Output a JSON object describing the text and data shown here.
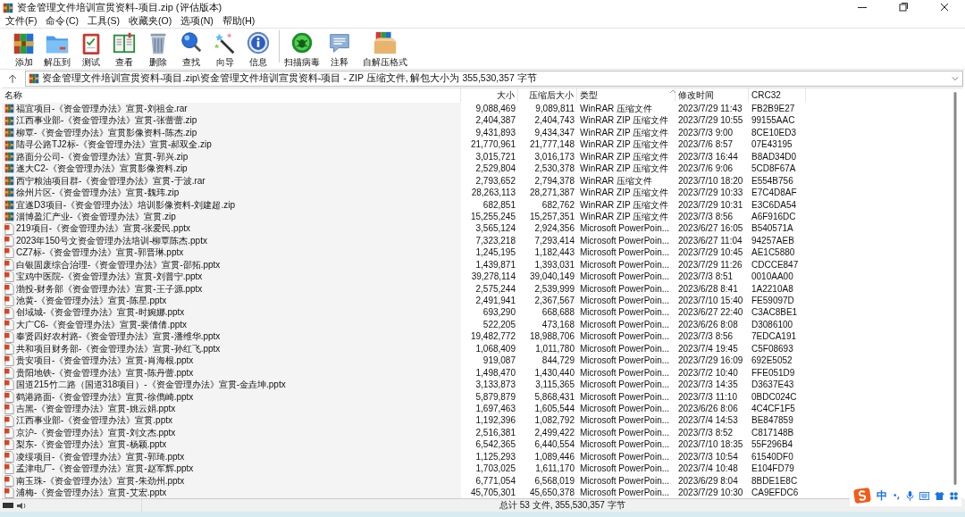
{
  "window": {
    "title": "资金管理文件培训宣贯资料-项目.zip (评估版本)"
  },
  "menu": [
    "文件(F)",
    "命令(C)",
    "工具(S)",
    "收藏夹(O)",
    "选项(N)",
    "帮助(H)"
  ],
  "toolbar": {
    "groups": [
      [
        "添加",
        "解压到",
        "测试",
        "查看",
        "删除",
        "查找",
        "向导",
        "信息"
      ],
      [
        "扫描病毒",
        "注释",
        "自解压格式"
      ]
    ]
  },
  "address": {
    "path": "资金管理文件培训宣贯资料-项目.zip\\资金管理文件培训宣贯资料-项目 - ZIP 压缩文件, 解包大小为 355,530,357 字节"
  },
  "table": {
    "columns": [
      "名称",
      "大小",
      "压缩后大小",
      "类型",
      "修改时间",
      "CRC32"
    ],
    "rows": [
      {
        "kind": "archive",
        "name": "福宜项目-《资金管理办法》宣贯-刘祖金.rar",
        "size": "9,088,469",
        "packed": "9,089,811",
        "type": "WinRAR 压缩文件",
        "modified": "2023/7/29 11:43",
        "crc": "FB2B9E27"
      },
      {
        "kind": "archive",
        "name": "江西事业部-《资金管理办法》宣贯-张蕾蕾.zip",
        "size": "2,404,387",
        "packed": "2,404,743",
        "type": "WinRAR ZIP 压缩文件",
        "modified": "2023/7/29 10:55",
        "crc": "99155AAC"
      },
      {
        "kind": "archive",
        "name": "柳覃-《资金管理办法》宣贯影像资料-陈杰.zip",
        "size": "9,431,893",
        "packed": "9,434,347",
        "type": "WinRAR ZIP 压缩文件",
        "modified": "2023/7/3 9:00",
        "crc": "8CE10ED3"
      },
      {
        "kind": "archive",
        "name": "陆寻公路TJ2标-《资金管理办法》宣贯-郝双全.zip",
        "size": "21,770,961",
        "packed": "21,777,148",
        "type": "WinRAR ZIP 压缩文件",
        "modified": "2023/7/6 8:57",
        "crc": "07E43195"
      },
      {
        "kind": "archive",
        "name": "路面分公司-《资金管理办法》宣贯-郭兴.zip",
        "size": "3,015,721",
        "packed": "3,016,173",
        "type": "WinRAR ZIP 压缩文件",
        "modified": "2023/7/3 16:44",
        "crc": "B8AD34D0"
      },
      {
        "kind": "archive",
        "name": "遂大C2-《资金管理办法》宣贯影像资料.zip",
        "size": "2,529,804",
        "packed": "2,530,378",
        "type": "WinRAR ZIP 压缩文件",
        "modified": "2023/7/6 9:06",
        "crc": "5CD8F67A"
      },
      {
        "kind": "archive",
        "name": "西宁粮油项目群-《资金管理办法》宣贯-于波.rar",
        "size": "2,793,652",
        "packed": "2,794,378",
        "type": "WinRAR 压缩文件",
        "modified": "2023/7/10 18:20",
        "crc": "E554B756"
      },
      {
        "kind": "archive",
        "name": "徐州片区-《资金管理办法》宣贯-魏玮.zip",
        "size": "28,263,113",
        "packed": "28,271,387",
        "type": "WinRAR ZIP 压缩文件",
        "modified": "2023/7/29 10:33",
        "crc": "E7C4D8AF"
      },
      {
        "kind": "archive",
        "name": "宜遂D3项目-《资金管理办法》培训影像资料-刘建超.zip",
        "size": "682,851",
        "packed": "682,762",
        "type": "WinRAR ZIP 压缩文件",
        "modified": "2023/7/29 10:31",
        "crc": "E3C6DA54"
      },
      {
        "kind": "archive",
        "name": "淄博盈汇产业-《资金管理办法》宣贯.zip",
        "size": "15,255,245",
        "packed": "15,257,351",
        "type": "WinRAR ZIP 压缩文件",
        "modified": "2023/7/3 8:56",
        "crc": "A6F916DC"
      },
      {
        "kind": "pptx",
        "name": "219项目-《资金管理办法》宣贯-张爱民.pptx",
        "size": "3,565,124",
        "packed": "2,924,356",
        "type": "Microsoft PowerPoin...",
        "modified": "2023/6/27 16:05",
        "crc": "B540571A"
      },
      {
        "kind": "pptx",
        "name": "2023年150号文资金管理办法培训-柳覃陈杰.pptx",
        "size": "7,323,218",
        "packed": "7,293,414",
        "type": "Microsoft PowerPoin...",
        "modified": "2023/6/27 11:04",
        "crc": "94257AEB"
      },
      {
        "kind": "pptx",
        "name": "CZ7标-《资金管理办法》宣贯-郭晋琳.pptx",
        "size": "1,245,195",
        "packed": "1,182,443",
        "type": "Microsoft PowerPoin...",
        "modified": "2023/7/29 10:45",
        "crc": "AE1C5880"
      },
      {
        "kind": "pptx",
        "name": "白银固废综合治理-《资金管理办法》宣贯-邵拓.pptx",
        "size": "1,439,871",
        "packed": "1,393,031",
        "type": "Microsoft PowerPoin...",
        "modified": "2023/7/29 11:26",
        "crc": "CDCCE847"
      },
      {
        "kind": "pptx",
        "name": "宝鸡中医院-《资金管理办法》宣贯-刘普宁.pptx",
        "size": "39,278,114",
        "packed": "39,040,149",
        "type": "Microsoft PowerPoin...",
        "modified": "2023/7/3 8:51",
        "crc": "0010AA00"
      },
      {
        "kind": "pptx",
        "name": "渤投-财务部《资金管理办法》宣贯-王子源.pptx",
        "size": "2,575,244",
        "packed": "2,539,999",
        "type": "Microsoft PowerPoin...",
        "modified": "2023/6/28 8:41",
        "crc": "1A2210A8"
      },
      {
        "kind": "pptx",
        "name": "池黄-《资金管理办法》宣贯-陈星.pptx",
        "size": "2,491,941",
        "packed": "2,367,567",
        "type": "Microsoft PowerPoin...",
        "modified": "2023/7/10 15:40",
        "crc": "FE59097D"
      },
      {
        "kind": "pptx",
        "name": "创域城-《资金管理办法》宣贯-时婉娜.pptx",
        "size": "693,290",
        "packed": "668,688",
        "type": "Microsoft PowerPoin...",
        "modified": "2023/6/27 22:40",
        "crc": "C3AC8BE1"
      },
      {
        "kind": "pptx",
        "name": "大广C6-《资金管理办法》宣贯-裴倩倩.pptx",
        "size": "522,205",
        "packed": "473,168",
        "type": "Microsoft PowerPoin...",
        "modified": "2023/6/26 8:08",
        "crc": "D3086100"
      },
      {
        "kind": "pptx",
        "name": "奉贤四好农村路-《资金管理办法》宣贯-潘维华.pptx",
        "size": "19,482,772",
        "packed": "18,988,706",
        "type": "Microsoft PowerPoin...",
        "modified": "2023/7/3 8:56",
        "crc": "7EDCA191"
      },
      {
        "kind": "pptx",
        "name": "共和项目财务部-《资金管理办法》宣贯-孙红飞.pptx",
        "size": "1,068,409",
        "packed": "1,011,780",
        "type": "Microsoft PowerPoin...",
        "modified": "2023/7/4 19:45",
        "crc": "C5F08693"
      },
      {
        "kind": "pptx",
        "name": "贵安项目-《资金管理办法》宣贯-肖海根.pptx",
        "size": "919,087",
        "packed": "844,729",
        "type": "Microsoft PowerPoin...",
        "modified": "2023/7/29 16:09",
        "crc": "692E5052"
      },
      {
        "kind": "pptx",
        "name": "贵阳地铁-《资金管理办法》宣贯-陈丹蕾.pptx",
        "size": "1,498,470",
        "packed": "1,430,440",
        "type": "Microsoft PowerPoin...",
        "modified": "2023/7/2 10:40",
        "crc": "FFE051D9"
      },
      {
        "kind": "pptx",
        "name": "国道215竹二路（国道318项目）-《资金管理办法》宣贯-金垚坤.pptx",
        "size": "3,133,873",
        "packed": "3,115,365",
        "type": "Microsoft PowerPoin...",
        "modified": "2023/7/3 14:35",
        "crc": "D3637E43"
      },
      {
        "kind": "pptx",
        "name": "鹤港路面-《资金管理办法》宣贯-徐儁崎.pptx",
        "size": "5,879,879",
        "packed": "5,868,431",
        "type": "Microsoft PowerPoin...",
        "modified": "2023/7/3 11:10",
        "crc": "0BDC024C"
      },
      {
        "kind": "pptx",
        "name": "吉黑-《资金管理办法》宣贯-姚云娟.pptx",
        "size": "1,697,463",
        "packed": "1,605,544",
        "type": "Microsoft PowerPoin...",
        "modified": "2023/6/26 8:06",
        "crc": "4C4CF1F5"
      },
      {
        "kind": "pptx",
        "name": "江西事业部-《资金管理办法》宣贯.pptx",
        "size": "1,192,396",
        "packed": "1,082,792",
        "type": "Microsoft PowerPoin...",
        "modified": "2023/7/4 14:53",
        "crc": "BE847859"
      },
      {
        "kind": "pptx",
        "name": "京沪-《资金管理办法》宣贯-刘文杰.pptx",
        "size": "2,516,381",
        "packed": "2,499,422",
        "type": "Microsoft PowerPoin...",
        "modified": "2023/7/3 8:52",
        "crc": "C817148B"
      },
      {
        "kind": "pptx",
        "name": "梨东-《资金管理办法》宣贯-杨颖.pptx",
        "size": "6,542,365",
        "packed": "6,440,554",
        "type": "Microsoft PowerPoin...",
        "modified": "2023/7/10 18:35",
        "crc": "55F296B4"
      },
      {
        "kind": "pptx",
        "name": "凌绥项目-《资金管理办法》宣贯-郭琦.pptx",
        "size": "1,125,293",
        "packed": "1,089,446",
        "type": "Microsoft PowerPoin...",
        "modified": "2023/7/3 10:54",
        "crc": "61540DF0"
      },
      {
        "kind": "pptx",
        "name": "孟津电厂-《资金管理办法》宣贯-赵军辉.pptx",
        "size": "1,703,025",
        "packed": "1,611,170",
        "type": "Microsoft PowerPoin...",
        "modified": "2023/7/4 10:48",
        "crc": "E104FD79"
      },
      {
        "kind": "pptx",
        "name": "南玉珠-《资金管理办法》宣贯-朱劲州.pptx",
        "size": "6,771,054",
        "packed": "6,568,019",
        "type": "Microsoft PowerPoin...",
        "modified": "2023/6/29 8:04",
        "crc": "8BDE1E8C"
      },
      {
        "kind": "pptx",
        "name": "浦梅-《资金管理办法》宣贯-艾宏.pptx",
        "size": "45,705,301",
        "packed": "45,650,378",
        "type": "Microsoft PowerPoin...",
        "modified": "2023/7/29 10:30",
        "crc": "CA9EFDC6"
      }
    ]
  },
  "status_bar": {
    "text": "总计 53 文件, 355,530,357 字节"
  },
  "ime_bar": {
    "label": "中"
  }
}
